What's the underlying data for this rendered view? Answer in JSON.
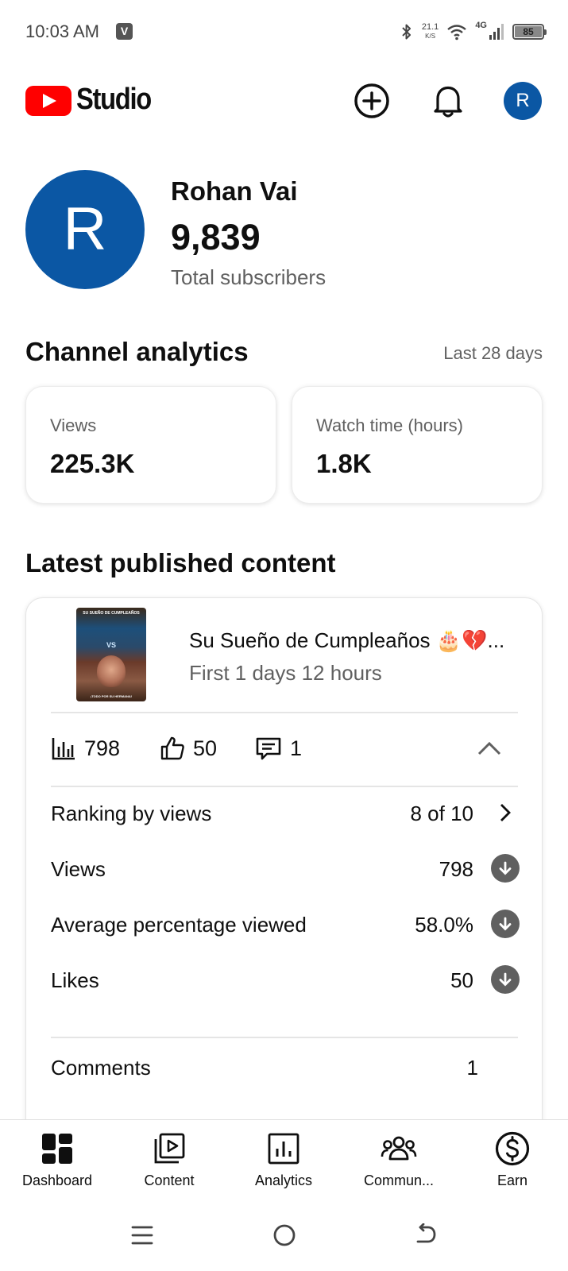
{
  "status_bar": {
    "time": "10:03 AM",
    "notification_badge": "V",
    "net_speed_value": "21.1",
    "net_speed_unit": "K/S",
    "network_type": "4G",
    "battery_level": "85"
  },
  "app_bar": {
    "logo_text": "Studio",
    "avatar_letter": "R"
  },
  "channel": {
    "avatar_letter": "R",
    "name": "Rohan Vai",
    "subscriber_count": "9,839",
    "subscriber_label": "Total subscribers"
  },
  "analytics": {
    "title": "Channel analytics",
    "period": "Last 28 days",
    "cards": [
      {
        "label": "Views",
        "value": "225.3K"
      },
      {
        "label": "Watch time (hours)",
        "value": "1.8K"
      }
    ]
  },
  "latest_content": {
    "title": "Latest published content",
    "video": {
      "title": "Su Sueño de Cumpleaños 🎂💔...",
      "age": "First 1 days 12 hours",
      "thumbnail_title": "SU SUEÑO DE CUMPLEAÑOS",
      "thumbnail_vs": "VS",
      "thumbnail_caption": "¡TODO POR SU HERMANA!"
    },
    "summary": {
      "views": "798",
      "likes": "50",
      "comments": "1"
    },
    "details": [
      {
        "label": "Ranking by views",
        "value": "8 of 10",
        "icon": "chevron-right-icon"
      },
      {
        "label": "Views",
        "value": "798",
        "icon": "arrow-down-circle-icon"
      },
      {
        "label": "Average percentage viewed",
        "value": "58.0%",
        "icon": "arrow-down-circle-icon"
      },
      {
        "label": "Likes",
        "value": "50",
        "icon": "arrow-down-circle-icon"
      },
      {
        "label": "Comments",
        "value": "1",
        "icon": ""
      }
    ]
  },
  "bottom_nav": {
    "items": [
      {
        "label": "Dashboard",
        "icon": "dashboard-icon",
        "active": true
      },
      {
        "label": "Content",
        "icon": "content-icon",
        "active": false
      },
      {
        "label": "Analytics",
        "icon": "analytics-icon",
        "active": false
      },
      {
        "label": "Commun...",
        "icon": "community-icon",
        "active": false
      },
      {
        "label": "Earn",
        "icon": "earn-icon",
        "active": false
      }
    ]
  },
  "colors": {
    "brand_red": "#ff0000",
    "avatar_blue": "#0b57a4",
    "text_primary": "#0f0f0f",
    "text_secondary": "#606060"
  }
}
